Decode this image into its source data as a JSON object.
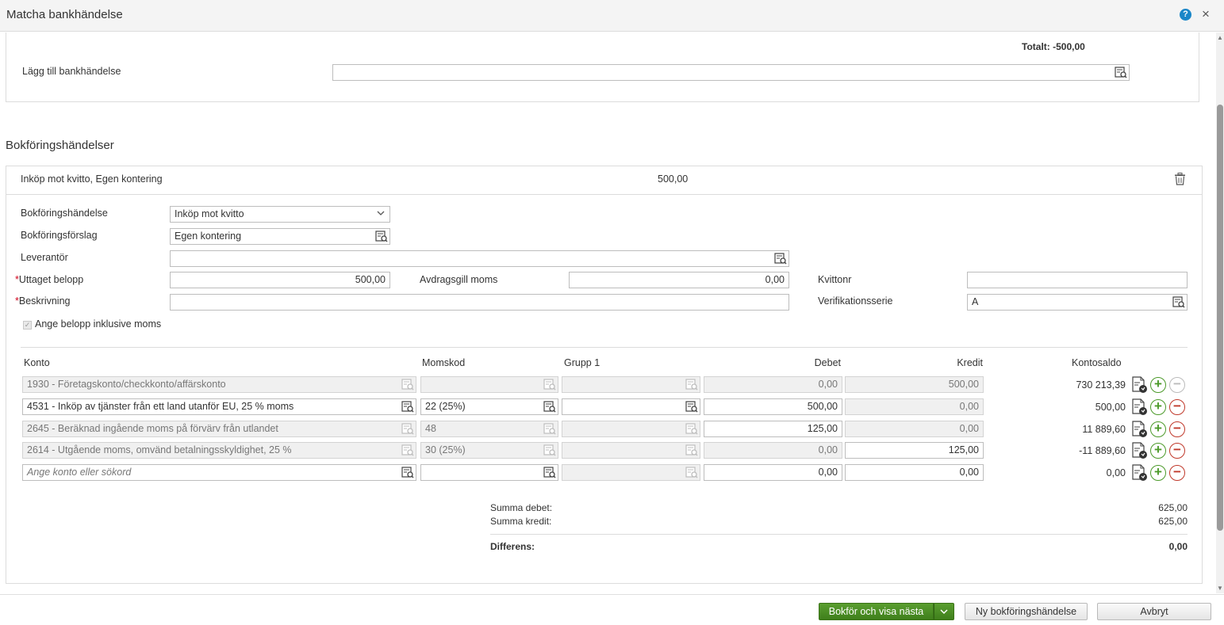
{
  "dialog": {
    "title": "Matcha bankhändelse",
    "help_icon": "?",
    "close_icon": "×"
  },
  "top": {
    "total": "Totalt: -500,00",
    "add_label": "Lägg till bankhändelse",
    "add_value": ""
  },
  "section": {
    "title": "Bokföringshändelser"
  },
  "event": {
    "header_name": "Inköp mot kvitto, Egen kontering",
    "header_amount": "500,00",
    "labels": {
      "bokforingshandelse": "Bokföringshändelse",
      "bokforingsforslag": "Bokföringsförslag",
      "leverantor": "Leverantör",
      "uttaget_belopp": "Uttaget belopp",
      "avdragsgill_moms": "Avdragsgill moms",
      "kvittonr": "Kvittonr",
      "beskrivning": "Beskrivning",
      "verifikationsserie": "Verifikationsserie",
      "inkl_moms": "Ange belopp inklusive moms"
    },
    "required_mark": "*",
    "values": {
      "bokforingshandelse": "Inköp mot kvitto",
      "bokforingsforslag": "Egen kontering",
      "leverantor": "",
      "uttaget_belopp": "500,00",
      "avdragsgill_moms": "0,00",
      "kvittonr": "",
      "beskrivning": "",
      "verifikationsserie": "A"
    }
  },
  "table": {
    "headers": {
      "konto": "Konto",
      "momskod": "Momskod",
      "grupp1": "Grupp 1",
      "debet": "Debet",
      "kredit": "Kredit",
      "kontosaldo": "Kontosaldo"
    },
    "rows": [
      {
        "konto": "1930 - Företagskonto/checkkonto/affärskonto",
        "momskod": "",
        "grupp1": "",
        "debet": "0,00",
        "kredit": "500,00",
        "saldo": "730 213,39"
      },
      {
        "konto": "4531 - Inköp av tjänster från ett land utanför EU, 25 % moms",
        "momskod": "22 (25%)",
        "grupp1": "",
        "debet": "500,00",
        "kredit": "0,00",
        "saldo": "500,00"
      },
      {
        "konto": "2645 - Beräknad ingående moms på förvärv från utlandet",
        "momskod": "48",
        "grupp1": "",
        "debet": "125,00",
        "kredit": "0,00",
        "saldo": "11 889,60"
      },
      {
        "konto": "2614 - Utgående moms, omvänd betalningsskyldighet, 25 %",
        "momskod": "30 (25%)",
        "grupp1": "",
        "debet": "0,00",
        "kredit": "125,00",
        "saldo": "-11 889,60"
      },
      {
        "konto_placeholder": "Ange konto eller sökord",
        "momskod": "",
        "grupp1": "",
        "debet": "0,00",
        "kredit": "0,00",
        "saldo": "0,00"
      }
    ],
    "plus_icon": "+",
    "minus_icon": "−"
  },
  "summary": {
    "summa_debet_label": "Summa debet:",
    "summa_debet": "625,00",
    "summa_kredit_label": "Summa kredit:",
    "summa_kredit": "625,00",
    "differens_label": "Differens:",
    "differens": "0,00"
  },
  "footer": {
    "primary": "Bokför och visa nästa",
    "dropdown_icon": "chevron-down",
    "new_event": "Ny bokföringshändelse",
    "cancel": "Avbryt"
  },
  "colors": {
    "primary_green": "#4c8f23",
    "plus_green": "#4c9a2a",
    "minus_red": "#c0392b",
    "help_blue": "#1a86c8",
    "required_red": "#d0021b"
  }
}
